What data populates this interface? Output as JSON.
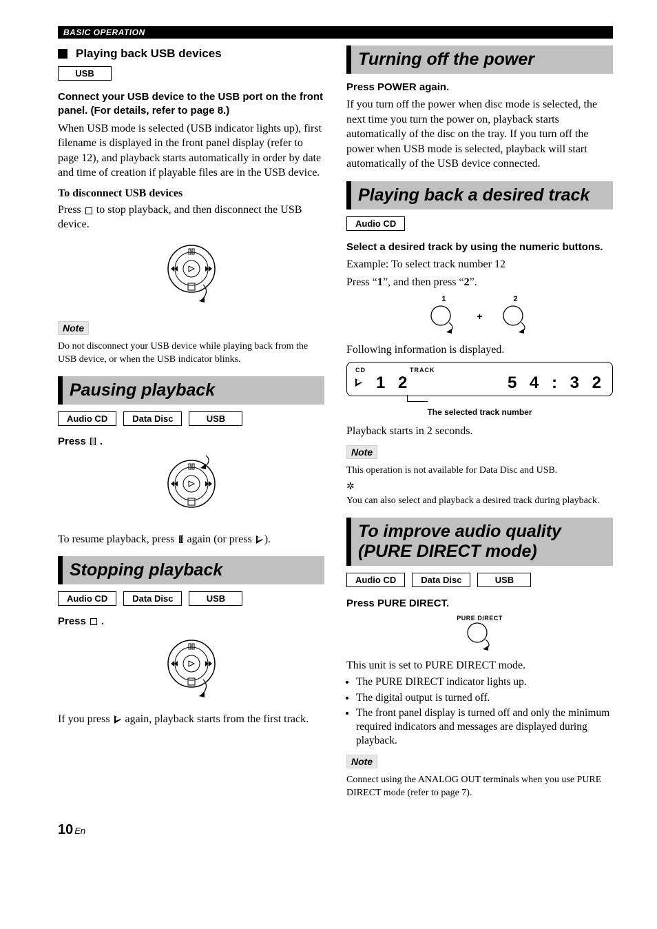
{
  "header": {
    "category": "BASIC OPERATION"
  },
  "left": {
    "usb_section": {
      "title": "Playing back USB devices",
      "chip_usb": "USB",
      "connect_heading": "Connect your USB device to the USB port on the front panel. (For details, refer to page 8.)",
      "connect_body": "When USB mode is selected (USB indicator lights up), first filename is displayed in the front panel display (refer to page 12), and playback starts automatically in order by date and time of creation if playable files are in the USB device.",
      "disconnect_heading": "To disconnect USB devices",
      "disconnect_line_a": "Press",
      "disconnect_line_b": "to stop playback, and then disconnect the USB device.",
      "note_label": "Note",
      "note_body": "Do not disconnect your USB device while playing back from the USB device, or when the USB indicator blinks."
    },
    "pausing": {
      "band": "Pausing playback",
      "chips": {
        "audio_cd": "Audio CD",
        "data_disc": "Data Disc",
        "usb": "USB"
      },
      "press_prefix": "Press",
      "press_suffix": ".",
      "resume_a": "To resume playback, press",
      "resume_b": "again (or press",
      "resume_c": ")."
    },
    "stopping": {
      "band": "Stopping playback",
      "chips": {
        "audio_cd": "Audio CD",
        "data_disc": "Data Disc",
        "usb": "USB"
      },
      "press_prefix": "Press",
      "press_suffix": ".",
      "footer_a": "If you press",
      "footer_b": "again, playback starts from the first track."
    }
  },
  "right": {
    "power_off": {
      "band": "Turning off the power",
      "press": "Press POWER again.",
      "body": "If you turn off the power when disc mode is selected, the next time you turn the power on, playback starts automatically of the disc on the tray. If you turn off the power when USB mode is selected, playback will start automatically of the USB device connected."
    },
    "desired_track": {
      "band": "Playing back a desired track",
      "chip_audio_cd": "Audio CD",
      "select_heading": "Select a desired track by using the numeric buttons.",
      "example": "Example: To select track number 12",
      "press_sequence_a": "Press “",
      "one": "1",
      "press_sequence_b": "”, and then press “",
      "two": "2",
      "press_sequence_c": "”.",
      "btn1_label": "1",
      "btn2_label": "2",
      "following": "Following information is displayed.",
      "display": {
        "cd": "CD",
        "track_label": "TRACK",
        "track_num": "1 2",
        "time": "5 4 : 3 2",
        "caption": "The selected track number"
      },
      "after": "Playback starts in 2 seconds.",
      "note_label": "Note",
      "note_body": "This operation is not available for Data Disc and USB.",
      "hint": "You can also select and playback a desired track during playback."
    },
    "pure_direct": {
      "band": "To improve audio quality (PURE DIRECT mode)",
      "chips": {
        "audio_cd": "Audio CD",
        "data_disc": "Data Disc",
        "usb": "USB"
      },
      "press": "Press PURE DIRECT.",
      "btn_label": "PURE DIRECT",
      "set_line": "This unit is set to PURE DIRECT mode.",
      "bullets": [
        "The PURE DIRECT indicator lights up.",
        "The digital output is turned off.",
        "The front panel display is turned off and only the minimum required indicators and messages are displayed during playback."
      ],
      "note_label": "Note",
      "note_body": "Connect using the ANALOG OUT terminals when you use PURE DIRECT mode (refer to page 7)."
    }
  },
  "page": {
    "num": "10",
    "suffix": "En"
  }
}
